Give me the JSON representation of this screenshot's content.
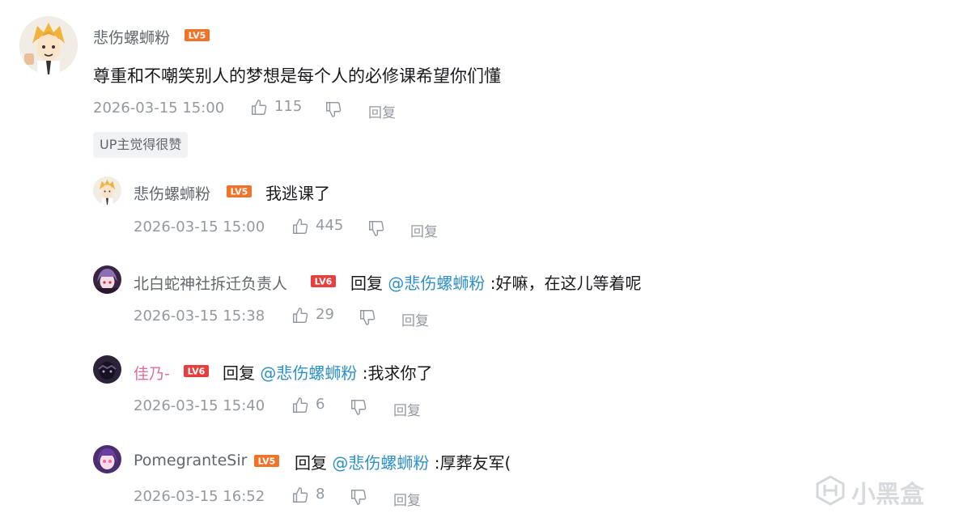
{
  "colors": {
    "level_badge": "#f0732a",
    "mention": "#2f8fc7",
    "pink_name": "#e06c9f"
  },
  "main_comment": {
    "avatar": "blonde-anime-avatar",
    "username": "悲伤螺蛳粉",
    "level": "LV5",
    "text": "尊重和不嘲笑别人的梦想是每个人的必修课希望你们懂",
    "time": "2026-03-15 15:00",
    "likes": "115",
    "reply_label": "回复",
    "badge": "UP主觉得很赞"
  },
  "replies": [
    {
      "avatar": "blonde-anime-avatar",
      "username": "悲伤螺蛳粉",
      "level": "LV5",
      "reply_prefix": "",
      "mention": "",
      "text": "我逃课了",
      "time": "2026-03-15 15:00",
      "likes": "445",
      "reply_label": "回复"
    },
    {
      "avatar": "purple-hair-avatar",
      "username": "北白蛇神社拆迁负责人",
      "level": "LV6",
      "reply_prefix": "回复",
      "mention": "@悲伤螺蛳粉",
      "text": ":好嘛，在这儿等着呢",
      "time": "2026-03-15 15:38",
      "likes": "29",
      "reply_label": "回复"
    },
    {
      "avatar": "dark-masked-avatar",
      "username": "佳乃-",
      "level": "LV6",
      "reply_prefix": "回复",
      "mention": "@悲伤螺蛳粉",
      "text": ":我求你了",
      "time": "2026-03-15 15:40",
      "likes": "6",
      "reply_label": "回复"
    },
    {
      "avatar": "star-eye-anime-avatar",
      "username": "PomegranteSir",
      "level": "LV5",
      "reply_prefix": "回复",
      "mention": "@悲伤螺蛳粉",
      "text": ":厚葬友军(",
      "time": "2026-03-15 16:52",
      "likes": "8",
      "reply_label": "回复"
    }
  ],
  "watermark": "小黑盒"
}
